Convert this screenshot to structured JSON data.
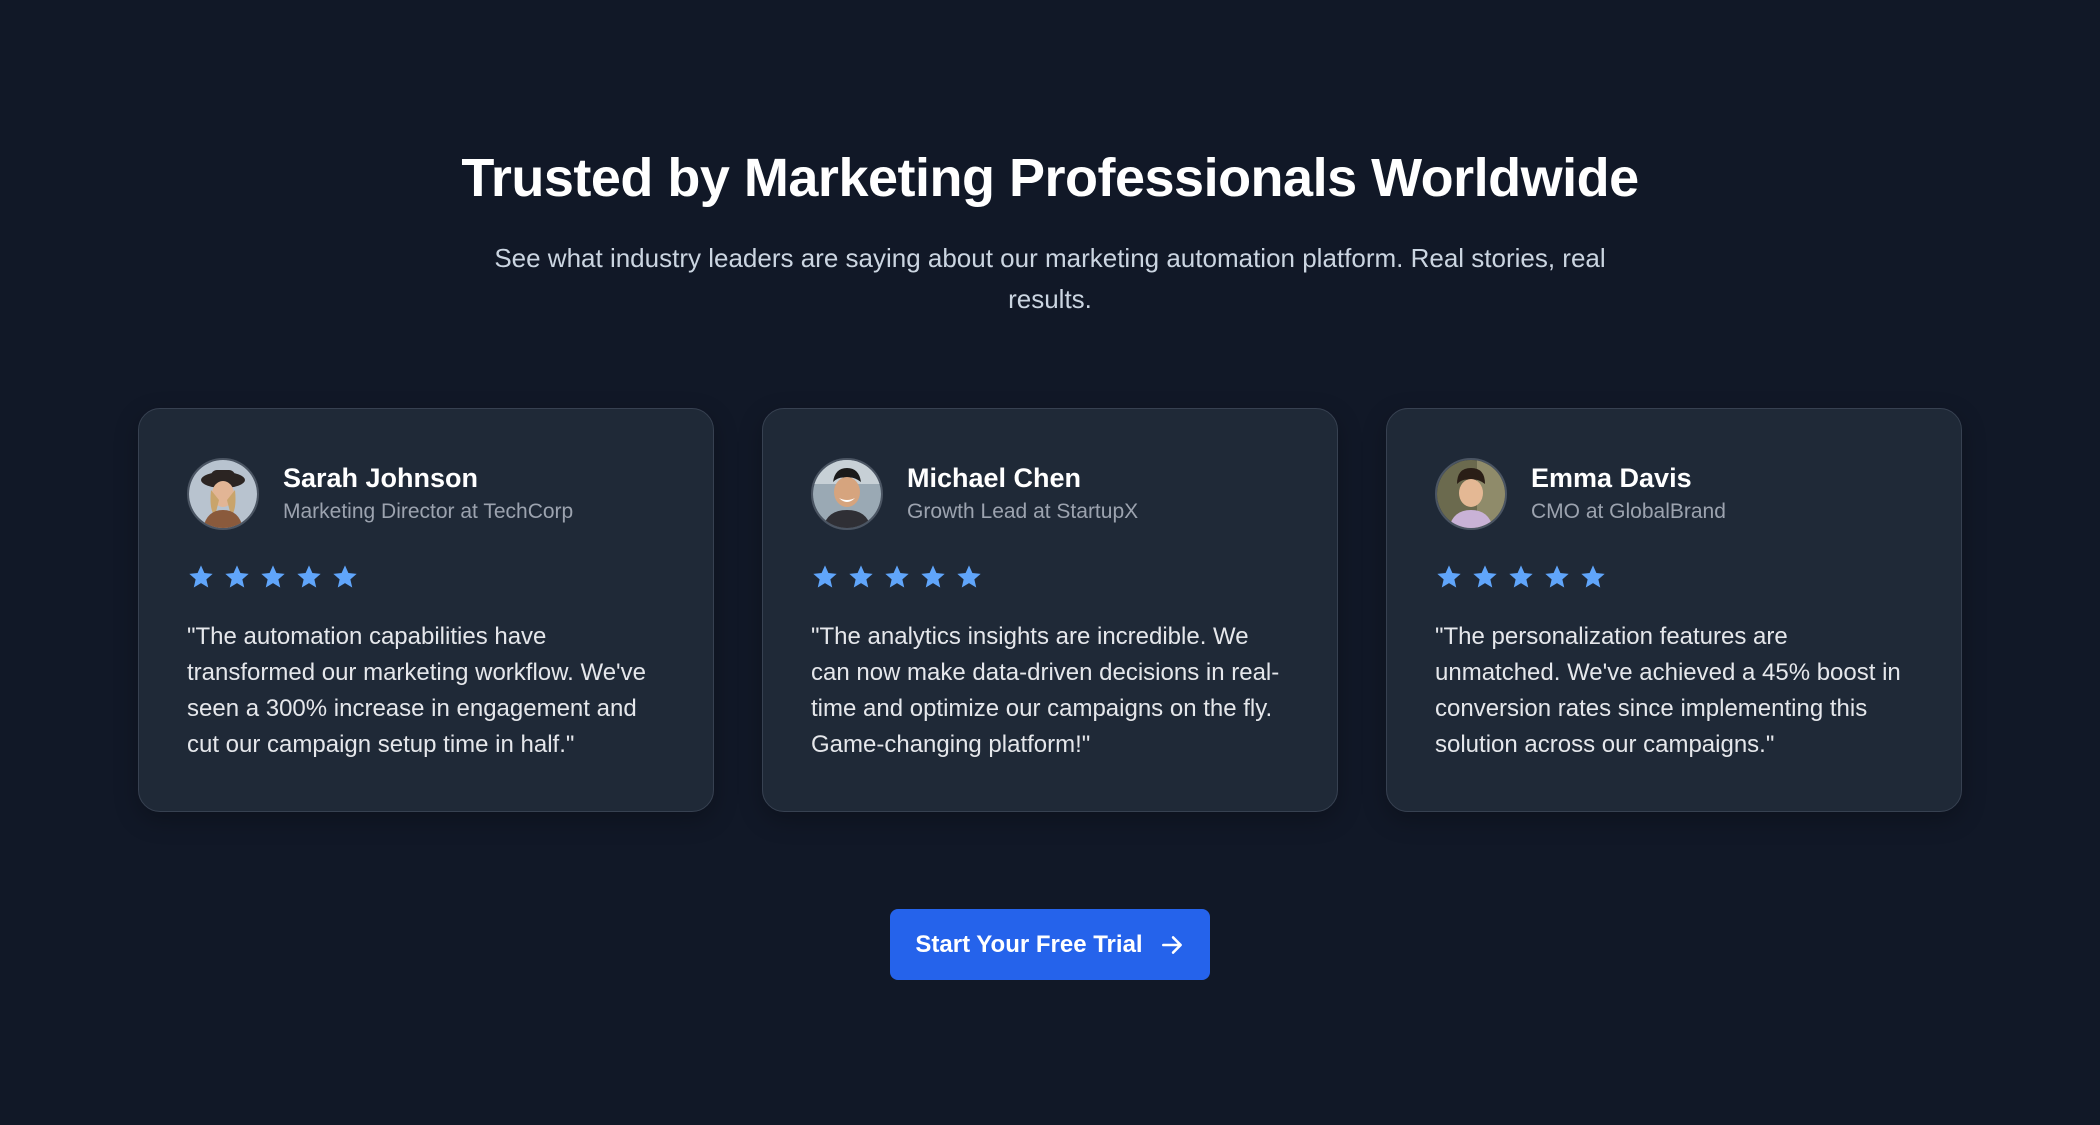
{
  "header": {
    "title": "Trusted by Marketing Professionals Worldwide",
    "subtitle": "See what industry leaders are saying about our marketing automation platform. Real stories, real results."
  },
  "colors": {
    "background": "#111827",
    "card": "#1f2937",
    "star": "#60a5fa",
    "button": "#2563eb"
  },
  "testimonials": [
    {
      "name": "Sarah Johnson",
      "role": "Marketing Director at TechCorp",
      "rating": 5,
      "rating_max": 5,
      "quote": "\"The automation capabilities have transformed our marketing workflow. We've seen a 300% increase in engagement and cut our campaign setup time in half.\""
    },
    {
      "name": "Michael Chen",
      "role": "Growth Lead at StartupX",
      "rating": 5,
      "rating_max": 5,
      "quote": "\"The analytics insights are incredible. We can now make data-driven decisions in real-time and optimize our campaigns on the fly. Game-changing platform!\""
    },
    {
      "name": "Emma Davis",
      "role": "CMO at GlobalBrand",
      "rating": 5,
      "rating_max": 5,
      "quote": "\"The personalization features are unmatched. We've achieved a 45% boost in conversion rates since implementing this solution across our campaigns.\""
    }
  ],
  "cta": {
    "label": "Start Your Free Trial",
    "icon": "arrow-right-icon"
  }
}
